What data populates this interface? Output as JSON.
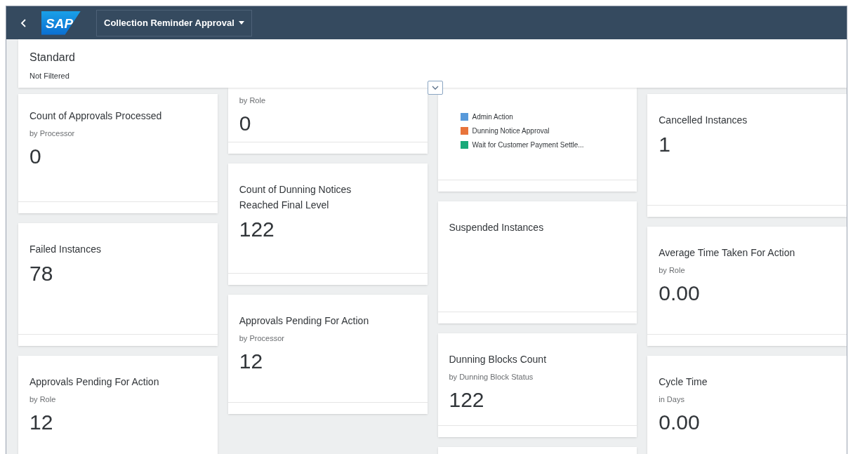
{
  "shell": {
    "logo": "SAP",
    "title": "Collection Reminder Approval"
  },
  "filter_bar": {
    "variant": "Standard",
    "status": "Not Filtered"
  },
  "columns": [
    [
      {
        "kind": "kpi",
        "title": "Count of Approvals Processed",
        "subtitle": "by Processor",
        "value": "0"
      },
      {
        "kind": "kpi",
        "title": "Failed Instances",
        "value": "78"
      },
      {
        "kind": "kpi",
        "title": "Approvals Pending For Action",
        "subtitle": "by Role",
        "value": "12"
      }
    ],
    [
      {
        "kind": "kpi",
        "subtitle": "by Role",
        "value": "0"
      },
      {
        "kind": "kpi",
        "title": "Count of Dunning Notices Reached Final Level",
        "value": "122"
      },
      {
        "kind": "kpi",
        "title": "Approvals Pending For Action",
        "subtitle": "by Processor",
        "value": "12"
      }
    ],
    [
      {
        "kind": "legend",
        "items": [
          {
            "label": "Admin Action",
            "color": "#5899da"
          },
          {
            "label": "Dunning Notice Approval",
            "color": "#e8743b"
          },
          {
            "label": "Wait for Customer Payment Settle...",
            "color": "#19a979"
          }
        ]
      },
      {
        "kind": "kpi",
        "title": "Suspended Instances"
      },
      {
        "kind": "kpi",
        "title": "Dunning Blocks Count",
        "subtitle": "by Dunning Block Status",
        "value": "122"
      },
      {
        "kind": "empty"
      }
    ],
    [
      {
        "kind": "kpi",
        "title": "Cancelled Instances",
        "value": "1"
      },
      {
        "kind": "kpi",
        "title": "Average Time Taken For Action",
        "subtitle": "by Role",
        "value": "0.00"
      },
      {
        "kind": "kpi",
        "title": "Cycle Time",
        "subtitle": "in Days",
        "value": "0.00"
      }
    ]
  ]
}
